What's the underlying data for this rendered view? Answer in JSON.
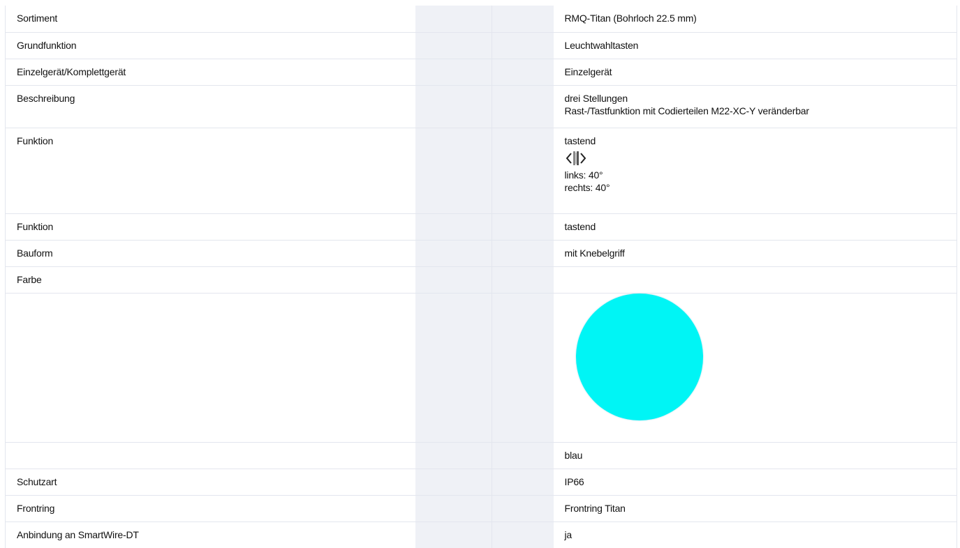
{
  "colors": {
    "swatch": "#00f5f5",
    "gray_column": "#eff1f6",
    "grid": "#e3e6ee"
  },
  "rows": [
    {
      "label": "Sortiment",
      "value": "RMQ-Titan (Bohrloch 22.5 mm)"
    },
    {
      "label": "Grundfunktion",
      "value": "Leuchtwahltasten"
    },
    {
      "label": "Einzelgerät/Komplettgerät",
      "value": "Einzelgerät"
    },
    {
      "label": "Beschreibung",
      "value_line1": "drei Stellungen",
      "value_line2": "Rast-/Tastfunktion mit Codierteilen M22-XC-Y veränderbar"
    },
    {
      "label": "Funktion",
      "value": "tastend",
      "icon": "selector-switch-icon",
      "detail_line1": "links: 40°",
      "detail_line2": "rechts: 40°"
    },
    {
      "label": "Funktion",
      "value": "tastend"
    },
    {
      "label": "Bauform",
      "value": "mit Knebelgriff"
    },
    {
      "label": "Farbe",
      "value": ""
    },
    {
      "label": "",
      "swatch_icon": "color-swatch-circle"
    },
    {
      "label": "",
      "value": "blau"
    },
    {
      "label": "Schutzart",
      "value": "IP66"
    },
    {
      "label": "Frontring",
      "value": "Frontring Titan"
    },
    {
      "label": "Anbindung an SmartWire-DT",
      "value": "ja"
    }
  ]
}
